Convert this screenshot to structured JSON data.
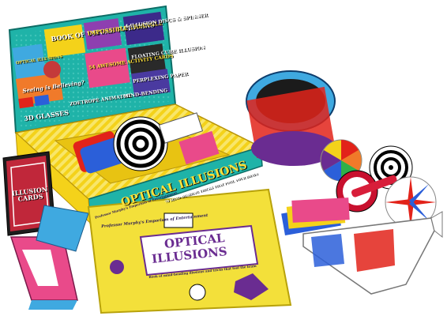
{
  "box": {
    "lid_titles": [
      "BOOK OF VISUAL TWISTERS",
      "IMPOSSIBLE TRIANGLE",
      "4 ILLUSION DISCS & SPINNER",
      "FLOATING CUBE ILLUSION",
      "54 AWESOME ACTIVITY CARDS",
      "PERPLEXING PAPER",
      "Seeing is Believing?",
      "3D GLASSES",
      "ZOETROPE ANIMATOR",
      "OPTICAL ILLUSIONS",
      "MIND-BENDING"
    ],
    "front_title": "OPTICAL ILLUSIONS",
    "front_subtitle": "70 MIND-BENDING TRICKS THAT FOOL YOUR BRAIN",
    "front_brand": "Professor Murphy's Emporium of Entertainment"
  },
  "cards_deck": {
    "title": "ILLUSION CARDS"
  },
  "book": {
    "brand": "Professor Murphy's Emporium of Entertainment",
    "title_line1": "OPTICAL",
    "title_line2": "ILLUSIONS",
    "subtitle": "Book of mind-bending illusions and tricks that fool the brain"
  },
  "colors": {
    "box_teal": "#1fb3a8",
    "box_inner_yellow": "#f4d21a",
    "book_yellow": "#f3e03a",
    "title_purple": "#6a2c91",
    "glasses_red": "#e2231a",
    "glasses_blue": "#2b5fd9"
  }
}
